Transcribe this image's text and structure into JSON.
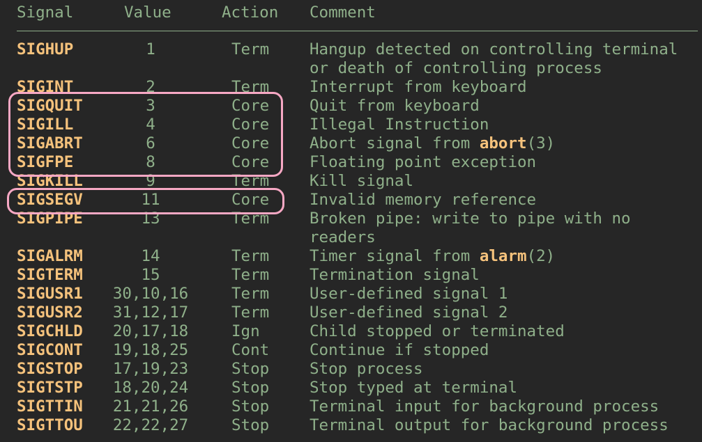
{
  "header": {
    "signal": "Signal",
    "value": "Value",
    "action": "Action",
    "comment": "Comment"
  },
  "rows": [
    {
      "signal": "SIGHUP",
      "value": "1",
      "action": "Term",
      "comment": "Hangup detected on controlling terminal",
      "comment2": "or death of controlling process"
    },
    {
      "signal": "SIGINT",
      "value": "2",
      "action": "Term",
      "comment": "Interrupt from keyboard"
    },
    {
      "signal": "SIGQUIT",
      "value": "3",
      "action": "Core",
      "comment": "Quit from keyboard"
    },
    {
      "signal": "SIGILL",
      "value": "4",
      "action": "Core",
      "comment": "Illegal Instruction"
    },
    {
      "signal": "SIGABRT",
      "value": "6",
      "action": "Core",
      "comment_pre": "Abort signal from ",
      "comment_bold": "abort",
      "comment_post": "(3)"
    },
    {
      "signal": "SIGFPE",
      "value": "8",
      "action": "Core",
      "comment": "Floating point exception"
    },
    {
      "signal": "SIGKILL",
      "value": "9",
      "action": "Term",
      "comment": "Kill signal"
    },
    {
      "signal": "SIGSEGV",
      "value": "11",
      "action": "Core",
      "comment": "Invalid memory reference"
    },
    {
      "signal": "SIGPIPE",
      "value": "13",
      "action": "Term",
      "comment": "Broken pipe: write to pipe with no",
      "comment2": "readers"
    },
    {
      "signal": "SIGALRM",
      "value": "14",
      "action": "Term",
      "comment_pre": "Timer signal from ",
      "comment_bold": "alarm",
      "comment_post": "(2)"
    },
    {
      "signal": "SIGTERM",
      "value": "15",
      "action": "Term",
      "comment": "Termination signal"
    },
    {
      "signal": "SIGUSR1",
      "value": "30,10,16",
      "action": "Term",
      "comment": "User-defined signal 1"
    },
    {
      "signal": "SIGUSR2",
      "value": "31,12,17",
      "action": "Term",
      "comment": "User-defined signal 2"
    },
    {
      "signal": "SIGCHLD",
      "value": "20,17,18",
      "action": "Ign",
      "comment": "Child stopped or terminated"
    },
    {
      "signal": "SIGCONT",
      "value": "19,18,25",
      "action": "Cont",
      "comment": "Continue if stopped"
    },
    {
      "signal": "SIGSTOP",
      "value": "17,19,23",
      "action": "Stop",
      "comment": "Stop process"
    },
    {
      "signal": "SIGTSTP",
      "value": "18,20,24",
      "action": "Stop",
      "comment": "Stop typed at terminal"
    },
    {
      "signal": "SIGTTIN",
      "value": "21,21,26",
      "action": "Stop",
      "comment": "Terminal input for background process"
    },
    {
      "signal": "SIGTTOU",
      "value": "22,22,27",
      "action": "Stop",
      "comment": "Terminal output for background process"
    }
  ],
  "highlights": [
    {
      "label": "core-dump-group",
      "signals": [
        "SIGQUIT",
        "SIGILL",
        "SIGABRT",
        "SIGFPE"
      ]
    },
    {
      "label": "segfault",
      "signals": [
        "SIGSEGV"
      ]
    }
  ],
  "colors": {
    "background": "#262626",
    "text": "#8fb08a",
    "signal": "#f5c27c",
    "highlight": "#f7a8c4"
  }
}
